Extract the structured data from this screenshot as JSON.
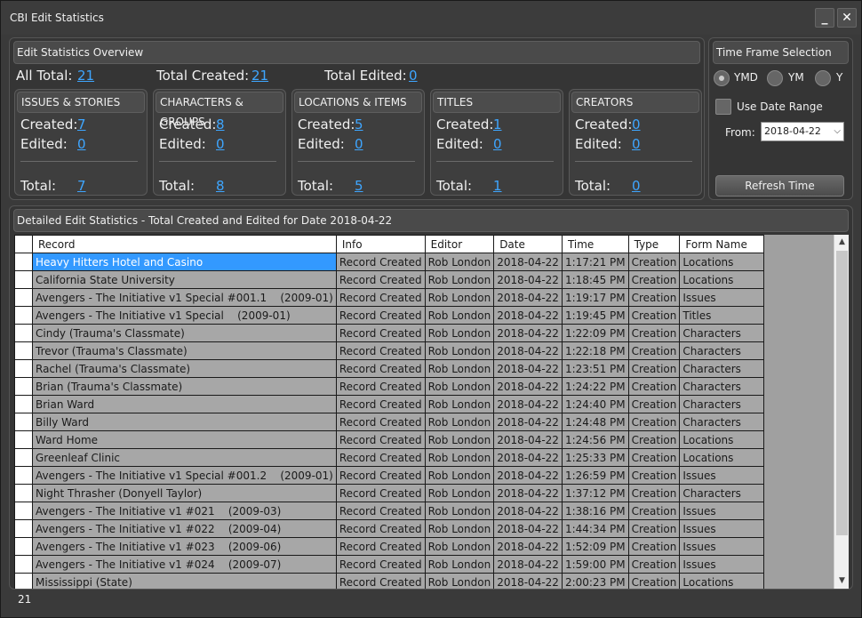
{
  "window": {
    "title": "CBI Edit Statistics",
    "minimize": "_",
    "close": "✕"
  },
  "overview": {
    "header": "Edit Statistics Overview",
    "all_total_label": "All Total:",
    "all_total": "21",
    "total_created_label": "Total Created:",
    "total_created": "21",
    "total_edited_label": "Total Edited:",
    "total_edited": "0",
    "categories": [
      {
        "title": "ISSUES & STORIES",
        "created": "7",
        "edited": "0",
        "total": "7"
      },
      {
        "title": "CHARACTERS & GROUPS",
        "created": "8",
        "edited": "0",
        "total": "8"
      },
      {
        "title": "LOCATIONS & ITEMS",
        "created": "5",
        "edited": "0",
        "total": "5"
      },
      {
        "title": "TITLES",
        "created": "1",
        "edited": "0",
        "total": "1"
      },
      {
        "title": "CREATORS",
        "created": "0",
        "edited": "0",
        "total": "0"
      }
    ],
    "labels": {
      "created": "Created:",
      "edited": "Edited:",
      "total": "Total:"
    }
  },
  "timeframe": {
    "header": "Time Frame Selection",
    "options": [
      "YMD",
      "YM",
      "Y"
    ],
    "selected": "YMD",
    "use_date_range_label": "Use Date Range",
    "from_label": "From:",
    "from_value": "2018-04-22",
    "refresh_label": "Refresh Time"
  },
  "detail": {
    "header": "Detailed Edit Statistics - Total Created and Edited for Date 2018-04-22",
    "columns": [
      "Record",
      "Info",
      "Editor",
      "Date",
      "Time",
      "Type",
      "Form Name"
    ],
    "rows": [
      [
        "Heavy Hitters Hotel and Casino",
        "Record Created",
        "Rob London",
        "2018-04-22",
        "1:17:21 PM",
        "Creation",
        "Locations"
      ],
      [
        "California State University",
        "Record Created",
        "Rob London",
        "2018-04-22",
        "1:18:45 PM",
        "Creation",
        "Locations"
      ],
      [
        "Avengers - The Initiative v1 Special #001.1    (2009-01)",
        "Record Created",
        "Rob London",
        "2018-04-22",
        "1:19:17 PM",
        "Creation",
        "Issues"
      ],
      [
        "Avengers - The Initiative v1 Special    (2009-01)",
        "Record Created",
        "Rob London",
        "2018-04-22",
        "1:19:45 PM",
        "Creation",
        "Titles"
      ],
      [
        "Cindy (Trauma's Classmate)",
        "Record Created",
        "Rob London",
        "2018-04-22",
        "1:22:09 PM",
        "Creation",
        "Characters"
      ],
      [
        "Trevor (Trauma's Classmate)",
        "Record Created",
        "Rob London",
        "2018-04-22",
        "1:22:18 PM",
        "Creation",
        "Characters"
      ],
      [
        "Rachel (Trauma's Classmate)",
        "Record Created",
        "Rob London",
        "2018-04-22",
        "1:23:51 PM",
        "Creation",
        "Characters"
      ],
      [
        "Brian (Trauma's Classmate)",
        "Record Created",
        "Rob London",
        "2018-04-22",
        "1:24:22 PM",
        "Creation",
        "Characters"
      ],
      [
        "Brian Ward",
        "Record Created",
        "Rob London",
        "2018-04-22",
        "1:24:40 PM",
        "Creation",
        "Characters"
      ],
      [
        "Billy Ward",
        "Record Created",
        "Rob London",
        "2018-04-22",
        "1:24:48 PM",
        "Creation",
        "Characters"
      ],
      [
        "Ward Home",
        "Record Created",
        "Rob London",
        "2018-04-22",
        "1:24:56 PM",
        "Creation",
        "Locations"
      ],
      [
        "Greenleaf Clinic",
        "Record Created",
        "Rob London",
        "2018-04-22",
        "1:25:33 PM",
        "Creation",
        "Locations"
      ],
      [
        "Avengers - The Initiative v1 Special #001.2    (2009-01)",
        "Record Created",
        "Rob London",
        "2018-04-22",
        "1:26:59 PM",
        "Creation",
        "Issues"
      ],
      [
        "Night Thrasher (Donyell Taylor)",
        "Record Created",
        "Rob London",
        "2018-04-22",
        "1:37:12 PM",
        "Creation",
        "Characters"
      ],
      [
        "Avengers - The Initiative v1 #021    (2009-03)",
        "Record Created",
        "Rob London",
        "2018-04-22",
        "1:38:16 PM",
        "Creation",
        "Issues"
      ],
      [
        "Avengers - The Initiative v1 #022    (2009-04)",
        "Record Created",
        "Rob London",
        "2018-04-22",
        "1:44:34 PM",
        "Creation",
        "Issues"
      ],
      [
        "Avengers - The Initiative v1 #023    (2009-06)",
        "Record Created",
        "Rob London",
        "2018-04-22",
        "1:52:09 PM",
        "Creation",
        "Issues"
      ],
      [
        "Avengers - The Initiative v1 #024    (2009-07)",
        "Record Created",
        "Rob London",
        "2018-04-22",
        "1:59:00 PM",
        "Creation",
        "Issues"
      ],
      [
        "Mississippi (State)",
        "Record Created",
        "Rob London",
        "2018-04-22",
        "2:00:23 PM",
        "Creation",
        "Locations"
      ]
    ],
    "selected_row": 0
  },
  "status": {
    "count": "21"
  },
  "colors": {
    "link": "#3ea6ff",
    "selection": "#3399ff",
    "grid_bg": "#a7a7a7"
  }
}
